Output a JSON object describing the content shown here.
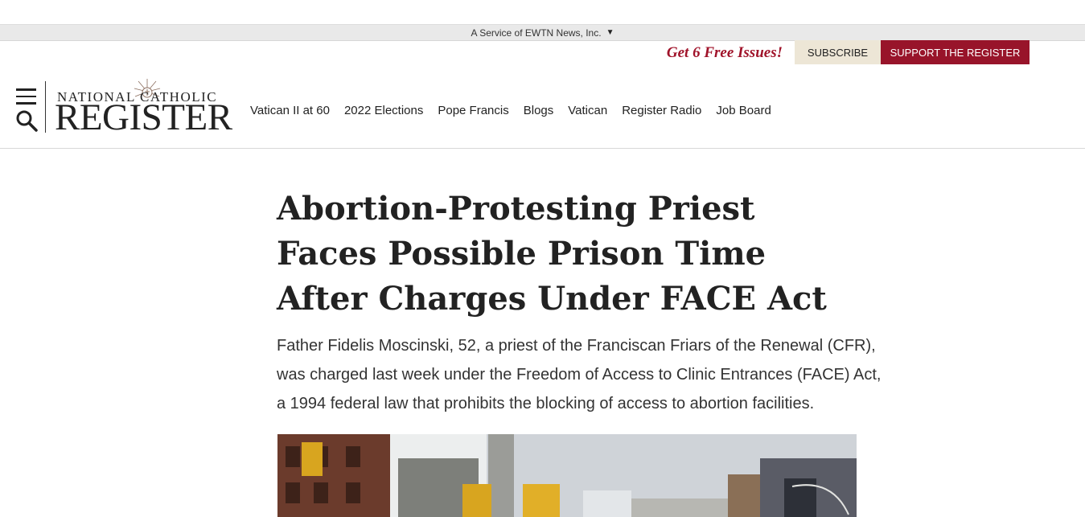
{
  "service_bar": {
    "text": "A Service of EWTN News, Inc."
  },
  "promo": {
    "free_issues": "Get 6 Free Issues!",
    "subscribe_label": "SUBSCRIBE",
    "support_label": "SUPPORT THE REGISTER"
  },
  "logo": {
    "line1": "NATIONAL CATHOLIC",
    "line2": "REGISTER"
  },
  "nav": {
    "items": [
      {
        "label": "Vatican II at 60"
      },
      {
        "label": "2022 Elections"
      },
      {
        "label": "Pope Francis"
      },
      {
        "label": "Blogs"
      },
      {
        "label": "Vatican"
      },
      {
        "label": "Register Radio"
      },
      {
        "label": "Job Board"
      }
    ]
  },
  "article": {
    "headline": "Abortion-Protesting Priest Faces Possible Prison Time After Charges Under FACE Act",
    "dek": "Father Fidelis Moscinski, 52, a priest of the Franciscan Friars of the Renewal (CFR), was charged last week under the Freedom of Access to Clinic Entrances (FACE) Act, a 1994 federal law that prohibits the blocking of access to abortion facilities."
  },
  "icons": {
    "menu": "hamburger-icon",
    "search": "search-icon",
    "dropdown": "caret-down-icon",
    "seal": "seal-icon"
  },
  "colors": {
    "brand_red": "#98142a",
    "promo_red": "#a0132a",
    "subscribe_bg": "#ede6d6",
    "service_bar_bg": "#e9e9e9"
  }
}
